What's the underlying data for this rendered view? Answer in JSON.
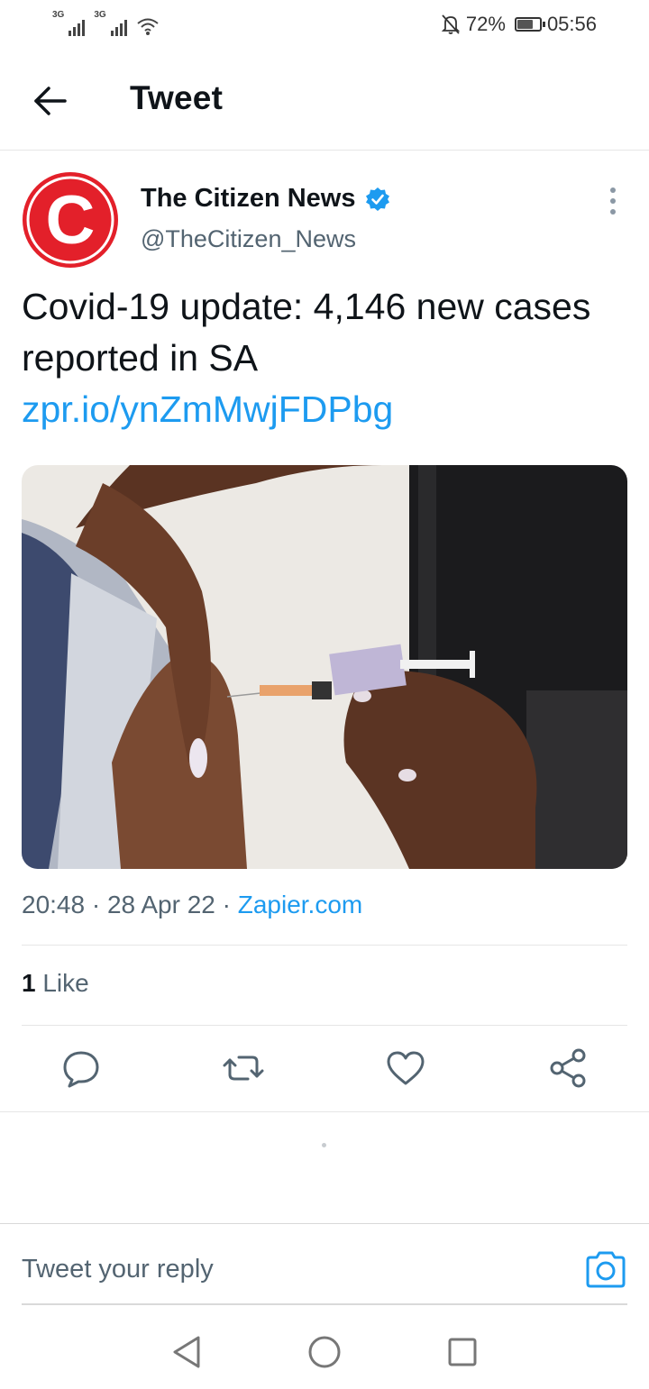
{
  "status_bar": {
    "network_1": "3G",
    "network_2": "3G",
    "battery_percent": "72%",
    "battery_level": 0.72,
    "time": "05:56"
  },
  "header": {
    "title": "Tweet",
    "back_icon": "arrow-left-icon"
  },
  "tweet": {
    "author_name": "The Citizen News",
    "author_handle": "@TheCitizen_News",
    "verified": true,
    "avatar_letter": "C",
    "text": "Covid-19 update: 4,146 new cases reported in SA",
    "link": "zpr.io/ynZmMwjFDPbg",
    "time": "20:48",
    "date": "28 Apr 22",
    "source": "Zapier.com",
    "separator": "·",
    "likes_count": "1",
    "likes_label": "Like"
  },
  "actions": [
    "reply-icon",
    "retweet-icon",
    "like-icon",
    "share-icon"
  ],
  "reply": {
    "placeholder": "Tweet your reply"
  },
  "colors": {
    "accent": "#1d9bf0",
    "brand_red": "#e3202a",
    "text_secondary": "#536471"
  }
}
